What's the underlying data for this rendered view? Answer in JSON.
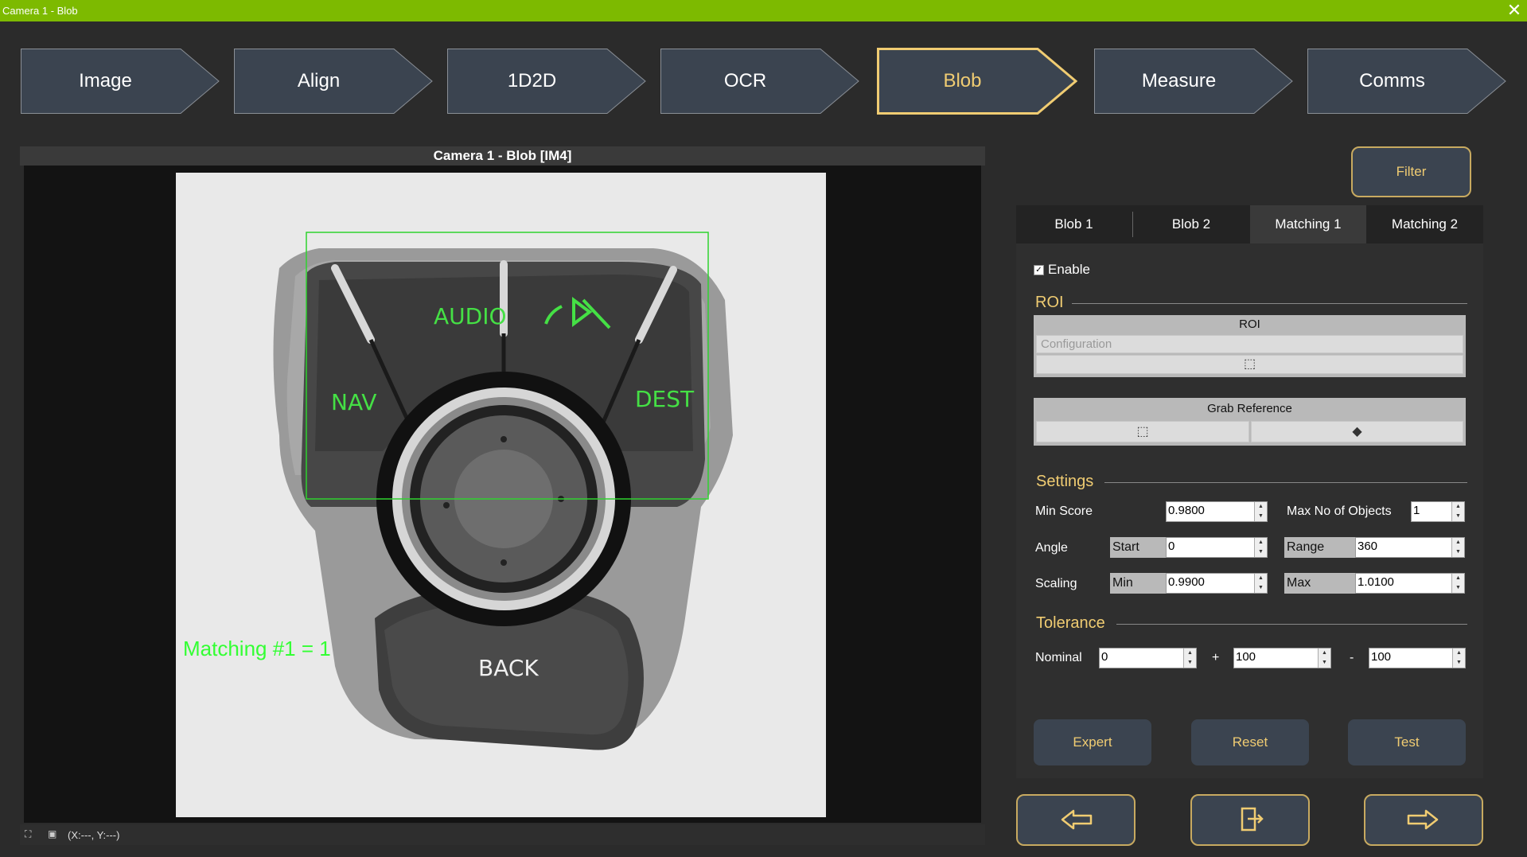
{
  "window": {
    "title": "Camera 1 - Blob"
  },
  "steps": [
    {
      "label": "Image",
      "active": false
    },
    {
      "label": "Align",
      "active": false
    },
    {
      "label": "1D2D",
      "active": false
    },
    {
      "label": "OCR",
      "active": false
    },
    {
      "label": "Blob",
      "active": true
    },
    {
      "label": "Measure",
      "active": false
    },
    {
      "label": "Comms",
      "active": false
    }
  ],
  "camera": {
    "header": "Camera 1 - Blob  [IM4]",
    "overlay_text": "Matching #1 = 1",
    "image_labels": {
      "audio": "AUDIO",
      "nav": "NAV",
      "dest": "DEST",
      "back": "BACK"
    },
    "coord": "(X:---, Y:---)"
  },
  "filter_button": "Filter",
  "tabs": [
    "Blob 1",
    "Blob 2",
    "Matching 1",
    "Matching 2"
  ],
  "active_tab": "Matching 1",
  "enable": {
    "label": "Enable",
    "checked": true
  },
  "roi": {
    "section": "ROI",
    "header": "ROI",
    "dropdown_value": "Configuration"
  },
  "grab_reference": {
    "label": "Grab Reference"
  },
  "settings": {
    "section": "Settings",
    "min_score_label": "Min Score",
    "min_score": "0.9800",
    "max_objects_label": "Max No of Objects",
    "max_objects": "1",
    "angle_label": "Angle",
    "angle_start_label": "Start",
    "angle_start": "0",
    "angle_range_label": "Range",
    "angle_range": "360",
    "scaling_label": "Scaling",
    "scaling_min_label": "Min",
    "scaling_min": "0.9900",
    "scaling_max_label": "Max",
    "scaling_max": "1.0100"
  },
  "tolerance": {
    "section": "Tolerance",
    "nominal_label": "Nominal",
    "nominal": "0",
    "plus_label": "+",
    "plus": "100",
    "minus_label": "-",
    "minus": "100"
  },
  "actions": {
    "expert": "Expert",
    "reset": "Reset",
    "test": "Test"
  },
  "colors": {
    "accent": "#f0cc72",
    "titlebar": "#7dba00",
    "overlay": "#33ff33"
  }
}
